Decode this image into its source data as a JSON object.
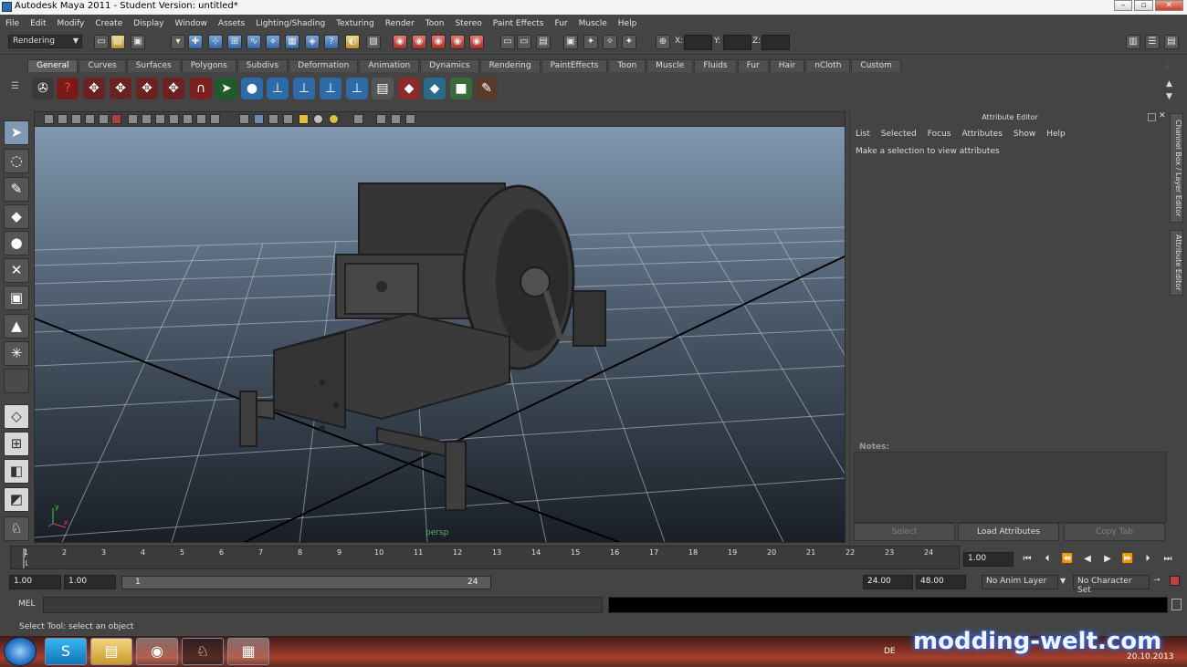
{
  "window": {
    "title": "Autodesk Maya 2011 - Student Version: untitled*",
    "buttons": [
      "–",
      "▫",
      "✕"
    ]
  },
  "menubar": [
    "File",
    "Edit",
    "Modify",
    "Create",
    "Display",
    "Window",
    "Assets",
    "Lighting/Shading",
    "Texturing",
    "Render",
    "Toon",
    "Stereo",
    "Paint Effects",
    "Fur",
    "Muscle",
    "Help"
  ],
  "statusline": {
    "mode": "Rendering",
    "x_label": "X:",
    "y_label": "Y:",
    "z_label": "Z:"
  },
  "shelf": {
    "tabs": [
      "General",
      "Curves",
      "Surfaces",
      "Polygons",
      "Subdivs",
      "Deformation",
      "Animation",
      "Dynamics",
      "Rendering",
      "PaintEffects",
      "Toon",
      "Muscle",
      "Fluids",
      "Fur",
      "Hair",
      "nCloth",
      "Custom"
    ],
    "active_tab": "General"
  },
  "viewport": {
    "camera_label": "persp"
  },
  "attribute_editor": {
    "title": "Attribute Editor",
    "menu": [
      "List",
      "Selected",
      "Focus",
      "Attributes",
      "Show",
      "Help"
    ],
    "message": "Make a selection to view attributes",
    "notes_label": "Notes:",
    "buttons": {
      "select": "Select",
      "load": "Load Attributes",
      "copy": "Copy Tab"
    }
  },
  "side_tabs": {
    "channel_box": "Channel Box / Layer Editor",
    "attribute_editor": "Attribute Editor"
  },
  "timeline": {
    "ticks": [
      "1",
      "2",
      "3",
      "4",
      "5",
      "6",
      "7",
      "8",
      "9",
      "10",
      "11",
      "12",
      "13",
      "14",
      "15",
      "16",
      "17",
      "18",
      "19",
      "20",
      "21",
      "22",
      "23",
      "24"
    ],
    "current_marker": "1",
    "current_frame": "1.00"
  },
  "range": {
    "start_time": "1.00",
    "playback_start": "1.00",
    "slider_start": "1",
    "slider_end": "24",
    "playback_end": "24.00",
    "end_time": "48.00",
    "anim_layer": "No Anim Layer",
    "character_set": "No Character Set"
  },
  "command_line": {
    "label": "MEL"
  },
  "help_line": {
    "text": "Select Tool: select an object"
  },
  "taskbar": {
    "language": "DE",
    "date": "20.10.2013"
  },
  "watermark": "modding-welt.com",
  "colors": {
    "ui_gray": "#444444",
    "viewport_top": "#8097ae",
    "viewport_bottom": "#1a1f26",
    "active_tool": "#7f98b3"
  }
}
